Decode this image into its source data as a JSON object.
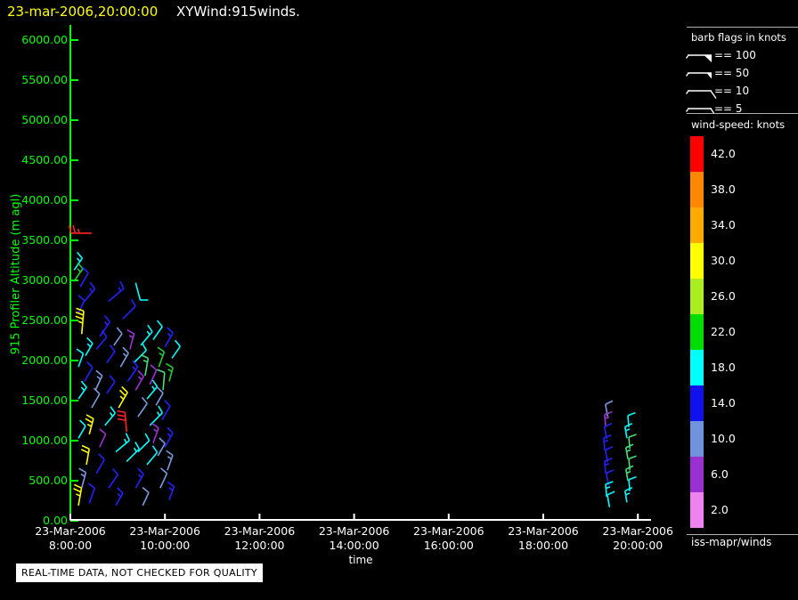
{
  "header": {
    "datetime": "23-mar-2006,20:00:00",
    "title": "XYWind:915winds."
  },
  "footer": {
    "banner": "REAL-TIME DATA, NOT CHECKED FOR QUALITY"
  },
  "legend": {
    "barb_title": "barb flags in knots",
    "barb_rows": [
      {
        "label": "== 100",
        "flag": "pennant-large"
      },
      {
        "label": "== 50",
        "flag": "pennant-small"
      },
      {
        "label": "== 10",
        "flag": "full-tick"
      },
      {
        "label": "== 5",
        "flag": "half-tick"
      }
    ],
    "speed_title": "wind-speed: knots",
    "credit": "iss-mapr/winds",
    "speed_levels": [
      {
        "value": "42.0",
        "color": "#ff0000"
      },
      {
        "value": "38.0",
        "color": "#ff8800"
      },
      {
        "value": "34.0",
        "color": "#ffaa00"
      },
      {
        "value": "30.0",
        "color": "#ffff00"
      },
      {
        "value": "26.0",
        "color": "#aaee22"
      },
      {
        "value": "22.0",
        "color": "#00dd00"
      },
      {
        "value": "18.0",
        "color": "#00ffff"
      },
      {
        "value": "14.0",
        "color": "#1111ee"
      },
      {
        "value": "10.0",
        "color": "#6f94dd"
      },
      {
        "value": "6.0",
        "color": "#9b30d0"
      },
      {
        "value": "2.0",
        "color": "#ee82ee"
      }
    ]
  },
  "axes": {
    "x": {
      "label": "time",
      "date": "23-Mar-2006",
      "hours": [
        8,
        10,
        12,
        14,
        16,
        18,
        20
      ],
      "ticks": [
        "8:00:00",
        "10:00:00",
        "12:00:00",
        "14:00:00",
        "16:00:00",
        "18:00:00",
        "20:00:00"
      ]
    },
    "y": {
      "label": "915 Profiler Altitude (m agl)",
      "values": [
        0,
        500,
        1000,
        1500,
        2000,
        2500,
        3000,
        3500,
        4000,
        4500,
        5000,
        5500,
        6000
      ],
      "ticks": [
        "0.00",
        "500.00",
        "1000.00",
        "1500.00",
        "2000.00",
        "2500.00",
        "3000.00",
        "3500.00",
        "4000.00",
        "4500.00",
        "5000.00",
        "5500.00",
        "6000.00"
      ]
    }
  },
  "colors": {
    "background": "#000000",
    "y_axis": "#00ff00",
    "x_axis": "#ffffff",
    "title_date": "#ffff00",
    "title_text": "#ffffff",
    "separator": "#b0b0b0"
  },
  "chart_data": {
    "type": "scatter",
    "subtype": "wind-barb-time-height-profile",
    "title": "XYWind:915winds.",
    "xlabel": "time",
    "ylabel": "915 Profiler Altitude (m agl)",
    "x_unit": "hours on 23-Mar-2006",
    "y_unit": "m agl",
    "xlim": [
      8,
      20.28
    ],
    "ylim": [
      0,
      6080
    ],
    "grid": false,
    "legend_position": "right",
    "speed_colors_knots": {
      "2": "#ee82ee",
      "6": "#9b30d0",
      "10": "#6f94dd",
      "14": "#1111ee",
      "18": "#00ffff",
      "22": "#00dd00",
      "26": "#aaee22",
      "30": "#ffff00",
      "34": "#ffaa00",
      "38": "#ff8800",
      "42": "#ff0000"
    },
    "barb_color_hex": {
      "cy": "#00ffff",
      "bl": "#2222ff",
      "cf": "#7b9be0",
      "vi": "#9b33d6",
      "ye": "#ffff00",
      "re": "#ff2222",
      "gr": "#22cc33",
      "sg": "#44e077"
    },
    "barb_format": [
      "hour",
      "altitude_m",
      "color_key",
      "full_barbs",
      "half_barbs",
      "angle_deg",
      "shaft_px",
      "tick_side_optional"
    ],
    "barbs": [
      [
        8.08,
        3130,
        "cy",
        1,
        1,
        55,
        16
      ],
      [
        8.09,
        3000,
        "gr",
        1,
        1,
        55,
        16
      ],
      [
        8.21,
        2920,
        "bl",
        1,
        0,
        60,
        18
      ],
      [
        8.3,
        2740,
        "bl",
        1,
        1,
        50,
        18
      ],
      [
        8.17,
        2590,
        "bl",
        1,
        0,
        65,
        16
      ],
      [
        8.81,
        2740,
        "bl",
        1,
        1,
        40,
        22
      ],
      [
        9.11,
        2520,
        "bl",
        1,
        0,
        45,
        20
      ],
      [
        8.24,
        2330,
        "ye",
        3,
        1,
        85,
        26
      ],
      [
        8.62,
        2300,
        "bl",
        1,
        1,
        55,
        20
      ],
      [
        8.55,
        2140,
        "bl",
        1,
        0,
        50,
        18
      ],
      [
        9.38,
        2970,
        "cy",
        1,
        0,
        -75,
        20
      ],
      [
        9.49,
        2190,
        "cy",
        1,
        1,
        50,
        20
      ],
      [
        9.75,
        2260,
        "cy",
        1,
        0,
        55,
        18
      ],
      [
        9.26,
        2140,
        "vi",
        1,
        1,
        75,
        18
      ],
      [
        9.34,
        1970,
        "cy",
        1,
        0,
        45,
        20
      ],
      [
        10.0,
        2170,
        "bl",
        1,
        1,
        60,
        18
      ],
      [
        10.15,
        2030,
        "cy",
        1,
        0,
        55,
        16
      ],
      [
        9.06,
        1920,
        "cf",
        1,
        1,
        60,
        18
      ],
      [
        8.77,
        1970,
        "bl",
        1,
        0,
        55,
        16
      ],
      [
        8.32,
        2060,
        "cy",
        1,
        1,
        60,
        16
      ],
      [
        8.17,
        1920,
        "cy",
        1,
        0,
        70,
        16
      ],
      [
        9.21,
        1740,
        "bl",
        1,
        1,
        55,
        20
      ],
      [
        9.58,
        1810,
        "sg",
        1,
        1,
        80,
        20
      ],
      [
        9.87,
        1920,
        "gr",
        1,
        1,
        70,
        18
      ],
      [
        9.96,
        1630,
        "sg",
        1,
        0,
        85,
        20
      ],
      [
        8.3,
        1740,
        "bl",
        1,
        0,
        60,
        18
      ],
      [
        8.53,
        1630,
        "cf",
        1,
        1,
        65,
        18
      ],
      [
        8.77,
        1590,
        "bl",
        1,
        0,
        55,
        16
      ],
      [
        9.38,
        1630,
        "vi",
        1,
        1,
        60,
        18
      ],
      [
        9.68,
        1700,
        "vi",
        1,
        0,
        65,
        18
      ],
      [
        10.09,
        1740,
        "gr",
        1,
        1,
        75,
        16
      ],
      [
        8.17,
        1520,
        "cy",
        1,
        1,
        55,
        16
      ],
      [
        8.45,
        1410,
        "cf",
        1,
        0,
        60,
        18
      ],
      [
        9.02,
        1410,
        "ye",
        2,
        1,
        60,
        20
      ],
      [
        9.19,
        1110,
        "re",
        3,
        0,
        95,
        22
      ],
      [
        8.73,
        1190,
        "cy",
        1,
        1,
        50,
        18
      ],
      [
        9.43,
        1300,
        "cf",
        1,
        0,
        55,
        18
      ],
      [
        9.68,
        1190,
        "cy",
        1,
        1,
        45,
        20
      ],
      [
        9.94,
        1260,
        "bl",
        1,
        0,
        60,
        18
      ],
      [
        8.4,
        1080,
        "ye",
        2,
        1,
        75,
        18
      ],
      [
        8.17,
        1030,
        "cy",
        1,
        0,
        60,
        16
      ],
      [
        9.75,
        970,
        "vi",
        1,
        1,
        70,
        18
      ],
      [
        8.62,
        920,
        "vi",
        1,
        0,
        65,
        16
      ],
      [
        8.96,
        860,
        "cy",
        1,
        1,
        40,
        20
      ],
      [
        9.43,
        860,
        "cy",
        1,
        0,
        45,
        18
      ],
      [
        10.0,
        920,
        "bl",
        1,
        1,
        60,
        18
      ],
      [
        8.34,
        700,
        "ye",
        2,
        0,
        80,
        18
      ],
      [
        9.19,
        740,
        "cy",
        1,
        1,
        45,
        20
      ],
      [
        9.62,
        700,
        "cy",
        1,
        0,
        50,
        18
      ],
      [
        10.05,
        630,
        "cf",
        1,
        1,
        70,
        18
      ],
      [
        8.55,
        590,
        "bl",
        1,
        0,
        60,
        18
      ],
      [
        8.24,
        410,
        "cf",
        1,
        1,
        75,
        18
      ],
      [
        8.81,
        410,
        "bl",
        1,
        0,
        55,
        18
      ],
      [
        9.38,
        410,
        "bl",
        1,
        1,
        60,
        18
      ],
      [
        9.9,
        410,
        "cf",
        1,
        0,
        65,
        18
      ],
      [
        8.17,
        190,
        "ye",
        2,
        1,
        80,
        20
      ],
      [
        8.4,
        220,
        "bl",
        1,
        0,
        70,
        18
      ],
      [
        8.96,
        190,
        "bl",
        1,
        1,
        60,
        16
      ],
      [
        9.53,
        190,
        "cf",
        1,
        0,
        65,
        16
      ],
      [
        10.09,
        260,
        "bl",
        1,
        1,
        70,
        16
      ],
      [
        9.81,
        1440,
        "cf",
        1,
        0,
        60,
        16
      ],
      [
        8.92,
        2190,
        "cf",
        1,
        0,
        55,
        16
      ],
      [
        9.62,
        1520,
        "cy",
        1,
        1,
        50,
        18
      ],
      [
        9.85,
        810,
        "cf",
        1,
        0,
        60,
        16
      ],
      [
        8.45,
        3590,
        "re",
        2,
        1,
        180,
        23,
        -1
      ],
      [
        19.36,
        1300,
        "cf",
        1,
        0,
        100,
        14,
        -1
      ],
      [
        19.32,
        1170,
        "vi",
        1,
        1,
        95,
        14,
        -1
      ],
      [
        19.34,
        1020,
        "bl",
        1,
        0,
        100,
        14,
        -1
      ],
      [
        19.3,
        880,
        "bl",
        1,
        1,
        95,
        14,
        -1
      ],
      [
        19.36,
        730,
        "bl",
        1,
        0,
        100,
        14,
        -1
      ],
      [
        19.32,
        590,
        "bl",
        1,
        1,
        95,
        14,
        -1
      ],
      [
        19.38,
        440,
        "bl",
        1,
        0,
        100,
        14,
        -1
      ],
      [
        19.34,
        300,
        "cy",
        1,
        1,
        95,
        14,
        -1
      ],
      [
        19.4,
        170,
        "cy",
        1,
        0,
        100,
        14,
        -1
      ],
      [
        19.81,
        1170,
        "cy",
        1,
        0,
        95,
        13,
        -1
      ],
      [
        19.77,
        1030,
        "cy",
        1,
        1,
        100,
        13,
        -1
      ],
      [
        19.83,
        900,
        "sg",
        1,
        0,
        95,
        13,
        -1
      ],
      [
        19.79,
        770,
        "sg",
        1,
        1,
        100,
        13,
        -1
      ],
      [
        19.83,
        630,
        "sg",
        1,
        0,
        95,
        13,
        -1
      ],
      [
        19.79,
        500,
        "sg",
        1,
        1,
        100,
        13,
        -1
      ],
      [
        19.83,
        370,
        "cy",
        1,
        0,
        95,
        13,
        -1
      ],
      [
        19.77,
        230,
        "cy",
        1,
        1,
        100,
        13,
        -1
      ]
    ]
  }
}
